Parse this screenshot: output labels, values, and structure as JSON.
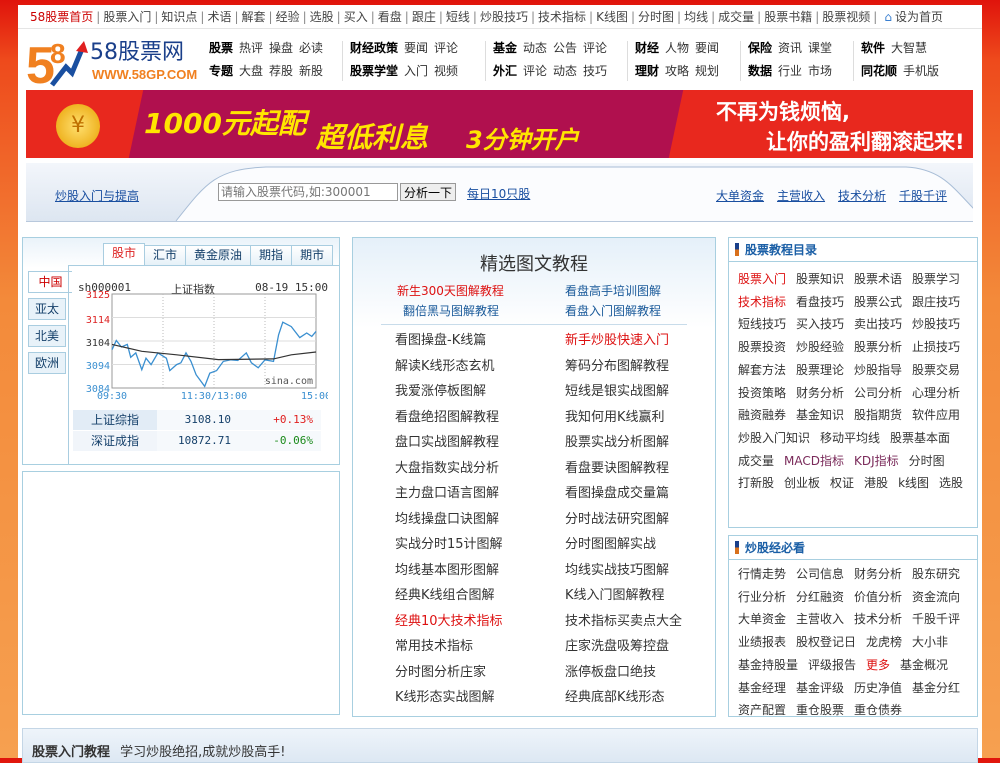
{
  "top_nav": {
    "home": "58股票首页",
    "items": [
      "股票入门",
      "知识点",
      "术语",
      "解套",
      "经验",
      "选股",
      "买入",
      "看盘",
      "跟庄",
      "短线",
      "炒股技巧",
      "技术指标",
      "K线图",
      "分时图",
      "均线",
      "成交量",
      "股票书籍",
      "股票视频"
    ],
    "set_home": "设为首页"
  },
  "logo": {
    "text": "58股票网",
    "url_text": "WWW.58GP.COM"
  },
  "main_nav": [
    {
      "rows": [
        [
          "股票",
          "热评",
          "操盘",
          "必读"
        ],
        [
          "专题",
          "大盘",
          "荐股",
          "新股"
        ]
      ]
    },
    {
      "rows": [
        [
          "财经政策",
          "要闻",
          "评论"
        ],
        [
          "股票学堂",
          "入门",
          "视频"
        ]
      ]
    },
    {
      "rows": [
        [
          "基金",
          "动态",
          "公告",
          "评论"
        ],
        [
          "外汇",
          "评论",
          "动态",
          "技巧"
        ]
      ]
    },
    {
      "rows": [
        [
          "财经",
          "人物",
          "要闻"
        ],
        [
          "理财",
          "攻略",
          "规划"
        ]
      ]
    },
    {
      "rows": [
        [
          "保险",
          "资讯",
          "课堂"
        ],
        [
          "数据",
          "行业",
          "市场"
        ]
      ]
    },
    {
      "rows": [
        [
          "软件",
          "大智慧"
        ],
        [
          "同花顺",
          "手机版"
        ]
      ]
    }
  ],
  "banner": {
    "text1": "1000元起配",
    "text2": "超低利息",
    "text3": "3分钟开户",
    "slogan1": "不再为钱烦恼,",
    "slogan2": "让你的盈利翻滚起来!"
  },
  "search": {
    "left_link": "炒股入门与提高",
    "placeholder": "请输入股票代码,如:300001",
    "button": "分析一下",
    "daily": "每日10只股",
    "right_links": [
      "大单资金",
      "主营收入",
      "技术分析",
      "千股千评"
    ]
  },
  "market": {
    "tabs": [
      "股市",
      "汇市",
      "黄金原油",
      "期指",
      "期市"
    ],
    "regions": [
      "中国",
      "亚太",
      "北美",
      "欧洲"
    ],
    "chart_header": {
      "code": "sh000001",
      "name": "上证指数",
      "time": "08-19 15:00"
    },
    "watermark": "sina.com",
    "quotes": [
      {
        "name": "上证综指",
        "value": "3108.10",
        "change": "+0.13%"
      },
      {
        "name": "深证成指",
        "value": "10872.71",
        "change": "-0.06%"
      }
    ]
  },
  "chart_data": {
    "type": "line",
    "ylim": [
      3084,
      3125
    ],
    "yticks": [
      "3125",
      "3114",
      "3104",
      "3094",
      "3084"
    ],
    "xticks": [
      "09:30",
      "11:30/13:00",
      "15:00"
    ],
    "grid": true,
    "series": [
      {
        "color": "#3a8fd0",
        "points": [
          [
            "09:30",
            3100.7
          ],
          [
            "09:35",
            3104.7
          ],
          [
            "09:41",
            3101.9
          ],
          [
            "09:48",
            3103
          ],
          [
            "09:52",
            3097.4
          ],
          [
            "09:58",
            3099.3
          ],
          [
            "10:05",
            3092
          ],
          [
            "10:10",
            3097
          ],
          [
            "10:16",
            3094.2
          ],
          [
            "10:24",
            3099.3
          ],
          [
            "10:34",
            3097
          ],
          [
            "10:38",
            3091.6
          ],
          [
            "10:46",
            3094.2
          ],
          [
            "10:51",
            3095
          ],
          [
            "10:57",
            3099.3
          ],
          [
            "11:03",
            3095.6
          ],
          [
            "11:09",
            3089.8
          ],
          [
            "11:19",
            3084.7
          ],
          [
            "11:25",
            3090.5
          ],
          [
            "13:03",
            3091.6
          ],
          [
            "13:11",
            3095.6
          ],
          [
            "13:20",
            3096.3
          ],
          [
            "13:28",
            3096
          ],
          [
            "13:38",
            3099.3
          ],
          [
            "13:44",
            3095
          ],
          [
            "13:52",
            3092.8
          ],
          [
            "14:00",
            3096.3
          ],
          [
            "14:10",
            3095.6
          ],
          [
            "14:16",
            3107.2
          ],
          [
            "14:21",
            3112.7
          ],
          [
            "14:31",
            3110.8
          ],
          [
            "14:41",
            3106
          ],
          [
            "14:49",
            3108
          ],
          [
            "14:55",
            3106.5
          ],
          [
            "15:00",
            3108.7
          ]
        ]
      },
      {
        "color": "#333333",
        "points": [
          [
            "09:30",
            3103
          ],
          [
            "10:05",
            3100
          ],
          [
            "10:46",
            3098.5
          ],
          [
            "13:05",
            3096.4
          ],
          [
            "14:10",
            3096.7
          ],
          [
            "14:31",
            3098.5
          ],
          [
            "15:00",
            3099.7
          ]
        ]
      }
    ]
  },
  "center": {
    "title": "精选图文教程",
    "featured": [
      {
        "label": "新生300天图解教程",
        "red": true
      },
      {
        "label": "看盘高手培训图解"
      },
      {
        "label": "翻倍黑马图解教程"
      },
      {
        "label": "看盘入门图解教程"
      }
    ],
    "left": [
      "看图操盘-K线篇",
      "解读K线形态玄机",
      "我爱涨停板图解",
      "看盘绝招图解教程",
      "盘口实战图解教程",
      "大盘指数实战分析",
      "主力盘口语言图解",
      "均线操盘口诀图解",
      "实战分时15计图解",
      "均线基本图形图解",
      "经典K线组合图解",
      "经典10大技术指标",
      "常用技术指标",
      "分时图分析庄家",
      "K线形态实战图解"
    ],
    "right": [
      "新手炒股快速入门",
      "筹码分布图解教程",
      "短线是银实战图解",
      "我知何用K线赢利",
      "股票实战分析图解",
      "看盘要诀图解教程",
      "看图操盘成交量篇",
      "分时战法研究图解",
      "分时图图解实战",
      "均线实战技巧图解",
      "K线入门图解教程",
      "技术指标买卖点大全",
      "庄家洗盘吸筹控盘",
      "涨停板盘口绝技",
      "经典底部K线形态"
    ],
    "red_items": [
      "经典10大技术指标",
      "新手炒股快速入门"
    ]
  },
  "catalog": {
    "title": "股票教程目录",
    "items": [
      "股票入门",
      "股票知识",
      "股票术语",
      "股票学习",
      "技术指标",
      "看盘技巧",
      "股票公式",
      "跟庄技巧",
      "短线技巧",
      "买入技巧",
      "卖出技巧",
      "炒股技巧",
      "股票投资",
      "炒股经验",
      "股票分析",
      "止损技巧",
      "解套方法",
      "股票理论",
      "炒股指导",
      "股票交易",
      "投资策略",
      "财务分析",
      "公司分析",
      "心理分析",
      "融资融券",
      "基金知识",
      "股指期货",
      "软件应用",
      "炒股入门知识",
      "移动平均线",
      "股票基本面",
      "成交量",
      "MACD指标",
      "KDJ指标",
      "分时图",
      "打新股",
      "创业板",
      "权证",
      "港股",
      "k线图",
      "选股"
    ],
    "red_items": [
      "股票入门",
      "技术指标"
    ]
  },
  "must_read": {
    "title": "炒股经必看",
    "items": [
      "行情走势",
      "公司信息",
      "财务分析",
      "股东研究",
      "行业分析",
      "分红融资",
      "价值分析",
      "资金流向",
      "大单资金",
      "主营收入",
      "技术分析",
      "千股千评",
      "业绩报表",
      "股权登记日",
      "龙虎榜",
      "大小非",
      "基金持股量",
      "评级报告",
      "更多",
      "基金概况",
      "基金经理",
      "基金评级",
      "历史净值",
      "基金分红",
      "资产配置",
      "重仓股票",
      "重仓债券"
    ],
    "red_items": [
      "更多"
    ]
  },
  "footer": {
    "title": "股票入门教程",
    "subtitle": "学习炒股绝招,成就炒股高手!"
  },
  "colors": {
    "accent_red": "#d11111",
    "link_blue": "#1a4fa0",
    "up": "#e02020",
    "down": "#1a8a1a"
  }
}
